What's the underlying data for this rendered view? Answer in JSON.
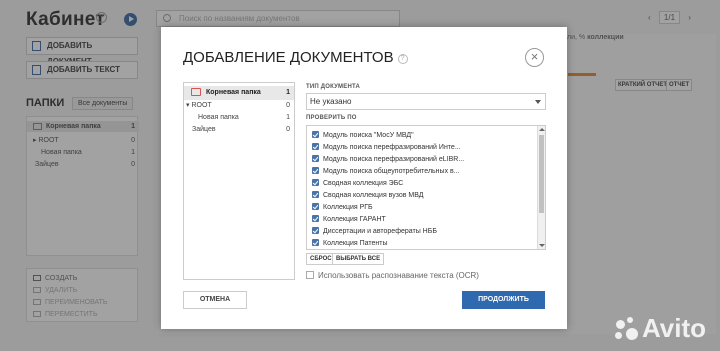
{
  "background": {
    "title": "Кабинет",
    "search_placeholder": "Поиск по названиям документов",
    "pager": {
      "page": "1/1"
    },
    "add_document": "ДОБАВИТЬ ДОКУМЕНТ",
    "add_text": "ДОБАВИТЬ ТЕКСТ",
    "folders_title": "ПАПКИ",
    "all_docs": "Все документы",
    "tree": [
      {
        "label": "Корневая папка",
        "count": "1"
      },
      {
        "label": "ROOT",
        "count": "0"
      },
      {
        "label": "Новая папка",
        "count": "1"
      },
      {
        "label": "Зайцев",
        "count": "0"
      }
    ],
    "actions": [
      {
        "label": "СОЗДАТЬ",
        "enabled": true
      },
      {
        "label": "УДАЛИТЬ",
        "enabled": false
      },
      {
        "label": "ПЕРЕИМЕНОВАТЬ",
        "enabled": false
      },
      {
        "label": "ПЕРЕМЕСТИТЬ",
        "enabled": false
      }
    ],
    "right_hint": "ли, %",
    "right_hint2": "коллекции",
    "short_report": "КРАТКИЙ ОТЧЕТ",
    "report": "ОТЧЕТ"
  },
  "modal": {
    "title": "ДОБАВЛЕНИЕ ДОКУМЕНТОВ",
    "help": "?",
    "close": "×",
    "tree": [
      {
        "label": "Корневая папка",
        "count": "1"
      },
      {
        "label": "▾ ROOT",
        "count": "0"
      },
      {
        "label": "Новая папка",
        "count": "1"
      },
      {
        "label": "Зайцев",
        "count": "0"
      }
    ],
    "doc_type_label": "ТИП ДОКУМЕНТА",
    "doc_type_value": "Не указано",
    "check_label": "ПРОВЕРИТЬ ПО",
    "checks": [
      "Модуль поиска \"МосУ МВД\"",
      "Модуль поиска перефразирований Инте...",
      "Модуль поиска перефразирований eLIBR...",
      "Модуль поиска общеупотребительных в...",
      "Сводная коллекция ЭБС",
      "Сводная коллекция вузов МВД",
      "Коллекция РГБ",
      "Коллекция ГАРАНТ",
      "Диссертации и авторефераты НББ",
      "Коллекция Патенты"
    ],
    "reset": "СБРОС",
    "select_all": "ВЫБРАТЬ ВСЕ",
    "ocr_label": "Использовать распознавание текста (OCR)",
    "cancel": "ОТМЕНА",
    "continue": "ПРОДОЛЖИТЬ"
  },
  "watermark": "Avito"
}
